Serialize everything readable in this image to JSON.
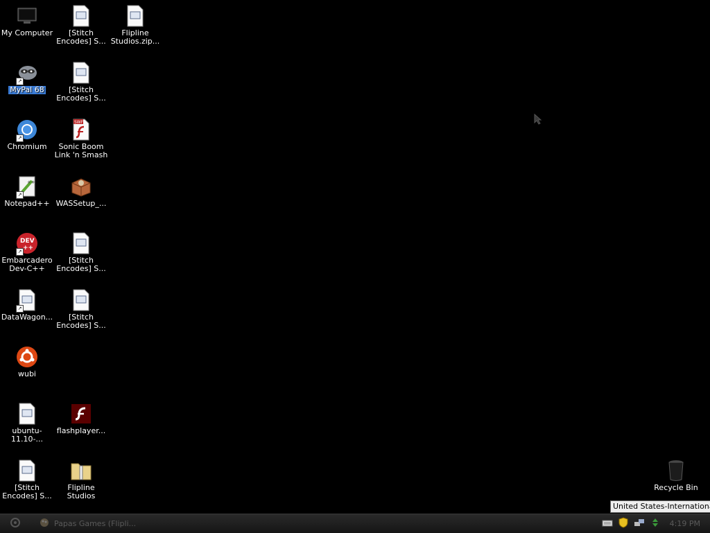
{
  "desktop": {
    "icons": [
      {
        "label": "My Computer"
      },
      {
        "label": "[Stitch Encodes] S..."
      },
      {
        "label": "Flipline Studios.zip..."
      },
      {
        "label": "MyPal 68"
      },
      {
        "label": "[Stitch Encodes] S..."
      },
      {
        "label": "Chromium"
      },
      {
        "label": "Sonic Boom Link 'n Smash"
      },
      {
        "label": "Notepad++"
      },
      {
        "label": "WASSetup_..."
      },
      {
        "label": "Embarcadero Dev-C++"
      },
      {
        "label": "[Stitch Encodes] S..."
      },
      {
        "label": "DataWagon..."
      },
      {
        "label": "[Stitch Encodes] S..."
      },
      {
        "label": "wubi"
      },
      {
        "label": "ubuntu-11.10-..."
      },
      {
        "label": "flashplayer..."
      },
      {
        "label": "[Stitch Encodes] S..."
      },
      {
        "label": "Flipline Studios"
      },
      {
        "label": "Recycle Bin"
      }
    ],
    "selected_icon": "MyPal 68"
  },
  "tooltip": {
    "text": "United States-International"
  },
  "taskbar": {
    "task_label": "Papas Games (Flipli...",
    "clock": "4:19 PM"
  }
}
